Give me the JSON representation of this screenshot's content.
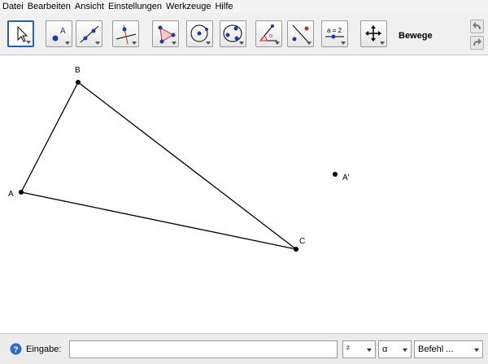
{
  "menubar": {
    "items": [
      "Datei",
      "Bearbeiten",
      "Ansicht",
      "Einstellungen",
      "Werkzeuge",
      "Hilfe"
    ]
  },
  "toolbar": {
    "tools": [
      "move-tool",
      "point-tool",
      "line-tool",
      "perpendicular-tool",
      "polygon-tool",
      "circle-tool",
      "conic-tool",
      "angle-tool",
      "reflect-tool",
      "slider-tool",
      "move-graphics-tool"
    ],
    "slider_caption": "a = 2",
    "active_tool_label": "Bewege"
  },
  "graphics": {
    "points": [
      {
        "label": "A"
      },
      {
        "label": "B"
      },
      {
        "label": "C"
      },
      {
        "label": "A'"
      }
    ]
  },
  "inputbar": {
    "label": "Eingabe:",
    "value": "",
    "dropdowns": [
      "²",
      "α",
      "Befehl ..."
    ]
  }
}
